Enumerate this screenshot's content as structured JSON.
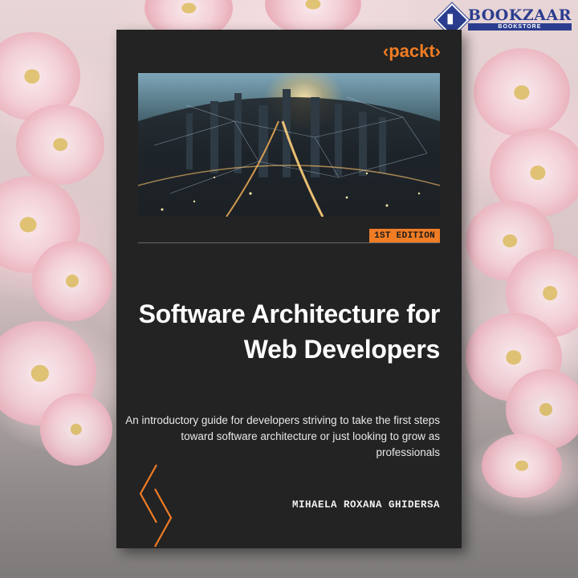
{
  "store_logo": {
    "name": "BOOKZAAR",
    "tagline": "BOOKSTORE",
    "brand_color": "#2b3d8f",
    "icon": "book-diamond-icon"
  },
  "book": {
    "publisher": "‹packt›",
    "edition": "1ST EDITION",
    "title_line1": "Software Architecture for",
    "title_line2": "Web Developers",
    "subtitle_line1": "An introductory guide for developers striving to take the first steps",
    "subtitle_line2": "toward software architecture or just looking to grow as professionals",
    "author": "MIHAELA ROXANA GHIDERSA",
    "accent_color": "#f07c24",
    "cover_color": "#232323",
    "decor_icon": "chevron-brackets-icon",
    "cover_image": "city-skyline-fisheye-photo"
  },
  "background": {
    "description_colors": [
      "#f4cfd6",
      "#8f8b8a"
    ]
  }
}
